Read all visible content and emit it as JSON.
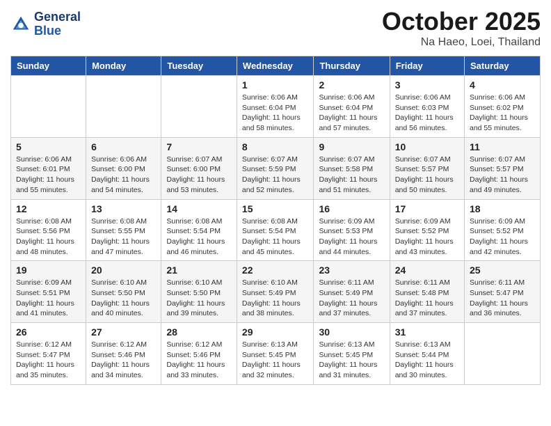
{
  "header": {
    "logo_line1": "General",
    "logo_line2": "Blue",
    "month": "October 2025",
    "location": "Na Haeo, Loei, Thailand"
  },
  "days_of_week": [
    "Sunday",
    "Monday",
    "Tuesday",
    "Wednesday",
    "Thursday",
    "Friday",
    "Saturday"
  ],
  "weeks": [
    [
      {
        "day": "",
        "info": ""
      },
      {
        "day": "",
        "info": ""
      },
      {
        "day": "",
        "info": ""
      },
      {
        "day": "1",
        "info": "Sunrise: 6:06 AM\nSunset: 6:04 PM\nDaylight: 11 hours\nand 58 minutes."
      },
      {
        "day": "2",
        "info": "Sunrise: 6:06 AM\nSunset: 6:04 PM\nDaylight: 11 hours\nand 57 minutes."
      },
      {
        "day": "3",
        "info": "Sunrise: 6:06 AM\nSunset: 6:03 PM\nDaylight: 11 hours\nand 56 minutes."
      },
      {
        "day": "4",
        "info": "Sunrise: 6:06 AM\nSunset: 6:02 PM\nDaylight: 11 hours\nand 55 minutes."
      }
    ],
    [
      {
        "day": "5",
        "info": "Sunrise: 6:06 AM\nSunset: 6:01 PM\nDaylight: 11 hours\nand 55 minutes."
      },
      {
        "day": "6",
        "info": "Sunrise: 6:06 AM\nSunset: 6:00 PM\nDaylight: 11 hours\nand 54 minutes."
      },
      {
        "day": "7",
        "info": "Sunrise: 6:07 AM\nSunset: 6:00 PM\nDaylight: 11 hours\nand 53 minutes."
      },
      {
        "day": "8",
        "info": "Sunrise: 6:07 AM\nSunset: 5:59 PM\nDaylight: 11 hours\nand 52 minutes."
      },
      {
        "day": "9",
        "info": "Sunrise: 6:07 AM\nSunset: 5:58 PM\nDaylight: 11 hours\nand 51 minutes."
      },
      {
        "day": "10",
        "info": "Sunrise: 6:07 AM\nSunset: 5:57 PM\nDaylight: 11 hours\nand 50 minutes."
      },
      {
        "day": "11",
        "info": "Sunrise: 6:07 AM\nSunset: 5:57 PM\nDaylight: 11 hours\nand 49 minutes."
      }
    ],
    [
      {
        "day": "12",
        "info": "Sunrise: 6:08 AM\nSunset: 5:56 PM\nDaylight: 11 hours\nand 48 minutes."
      },
      {
        "day": "13",
        "info": "Sunrise: 6:08 AM\nSunset: 5:55 PM\nDaylight: 11 hours\nand 47 minutes."
      },
      {
        "day": "14",
        "info": "Sunrise: 6:08 AM\nSunset: 5:54 PM\nDaylight: 11 hours\nand 46 minutes."
      },
      {
        "day": "15",
        "info": "Sunrise: 6:08 AM\nSunset: 5:54 PM\nDaylight: 11 hours\nand 45 minutes."
      },
      {
        "day": "16",
        "info": "Sunrise: 6:09 AM\nSunset: 5:53 PM\nDaylight: 11 hours\nand 44 minutes."
      },
      {
        "day": "17",
        "info": "Sunrise: 6:09 AM\nSunset: 5:52 PM\nDaylight: 11 hours\nand 43 minutes."
      },
      {
        "day": "18",
        "info": "Sunrise: 6:09 AM\nSunset: 5:52 PM\nDaylight: 11 hours\nand 42 minutes."
      }
    ],
    [
      {
        "day": "19",
        "info": "Sunrise: 6:09 AM\nSunset: 5:51 PM\nDaylight: 11 hours\nand 41 minutes."
      },
      {
        "day": "20",
        "info": "Sunrise: 6:10 AM\nSunset: 5:50 PM\nDaylight: 11 hours\nand 40 minutes."
      },
      {
        "day": "21",
        "info": "Sunrise: 6:10 AM\nSunset: 5:50 PM\nDaylight: 11 hours\nand 39 minutes."
      },
      {
        "day": "22",
        "info": "Sunrise: 6:10 AM\nSunset: 5:49 PM\nDaylight: 11 hours\nand 38 minutes."
      },
      {
        "day": "23",
        "info": "Sunrise: 6:11 AM\nSunset: 5:49 PM\nDaylight: 11 hours\nand 37 minutes."
      },
      {
        "day": "24",
        "info": "Sunrise: 6:11 AM\nSunset: 5:48 PM\nDaylight: 11 hours\nand 37 minutes."
      },
      {
        "day": "25",
        "info": "Sunrise: 6:11 AM\nSunset: 5:47 PM\nDaylight: 11 hours\nand 36 minutes."
      }
    ],
    [
      {
        "day": "26",
        "info": "Sunrise: 6:12 AM\nSunset: 5:47 PM\nDaylight: 11 hours\nand 35 minutes."
      },
      {
        "day": "27",
        "info": "Sunrise: 6:12 AM\nSunset: 5:46 PM\nDaylight: 11 hours\nand 34 minutes."
      },
      {
        "day": "28",
        "info": "Sunrise: 6:12 AM\nSunset: 5:46 PM\nDaylight: 11 hours\nand 33 minutes."
      },
      {
        "day": "29",
        "info": "Sunrise: 6:13 AM\nSunset: 5:45 PM\nDaylight: 11 hours\nand 32 minutes."
      },
      {
        "day": "30",
        "info": "Sunrise: 6:13 AM\nSunset: 5:45 PM\nDaylight: 11 hours\nand 31 minutes."
      },
      {
        "day": "31",
        "info": "Sunrise: 6:13 AM\nSunset: 5:44 PM\nDaylight: 11 hours\nand 30 minutes."
      },
      {
        "day": "",
        "info": ""
      }
    ]
  ]
}
